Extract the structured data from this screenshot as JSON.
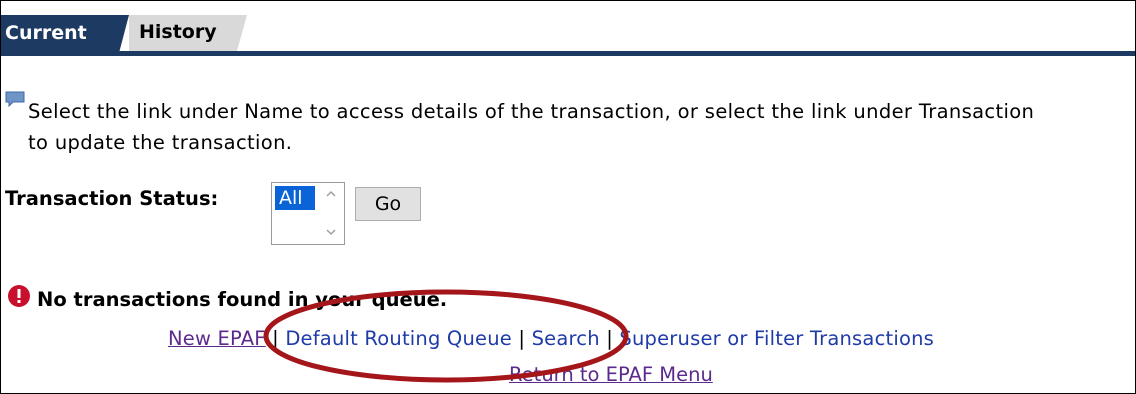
{
  "tabs": {
    "current": "Current",
    "history": "History"
  },
  "info": {
    "line1": "Select the link under Name to access details of the transaction, or select the link under Transaction",
    "line2": "to update the transaction.",
    "icon": "comment-icon"
  },
  "status": {
    "label": "Transaction Status:",
    "selected": "All",
    "go_label": "Go"
  },
  "message": {
    "icon": "error-icon",
    "text": "No transactions found in your queue."
  },
  "links": {
    "new_epaf": "New EPAF",
    "default_routing_queue": "Default Routing Queue",
    "search": "Search",
    "superuser": "Superuser or Filter Transactions",
    "separator": "|",
    "return": "Return to EPAF Menu"
  },
  "colors": {
    "tab_active": "#1d3a63",
    "tab_inactive": "#d9d9d9",
    "link_visited": "#5c2a8c",
    "link": "#1f3ba8",
    "highlight_oval": "#a4161a"
  }
}
